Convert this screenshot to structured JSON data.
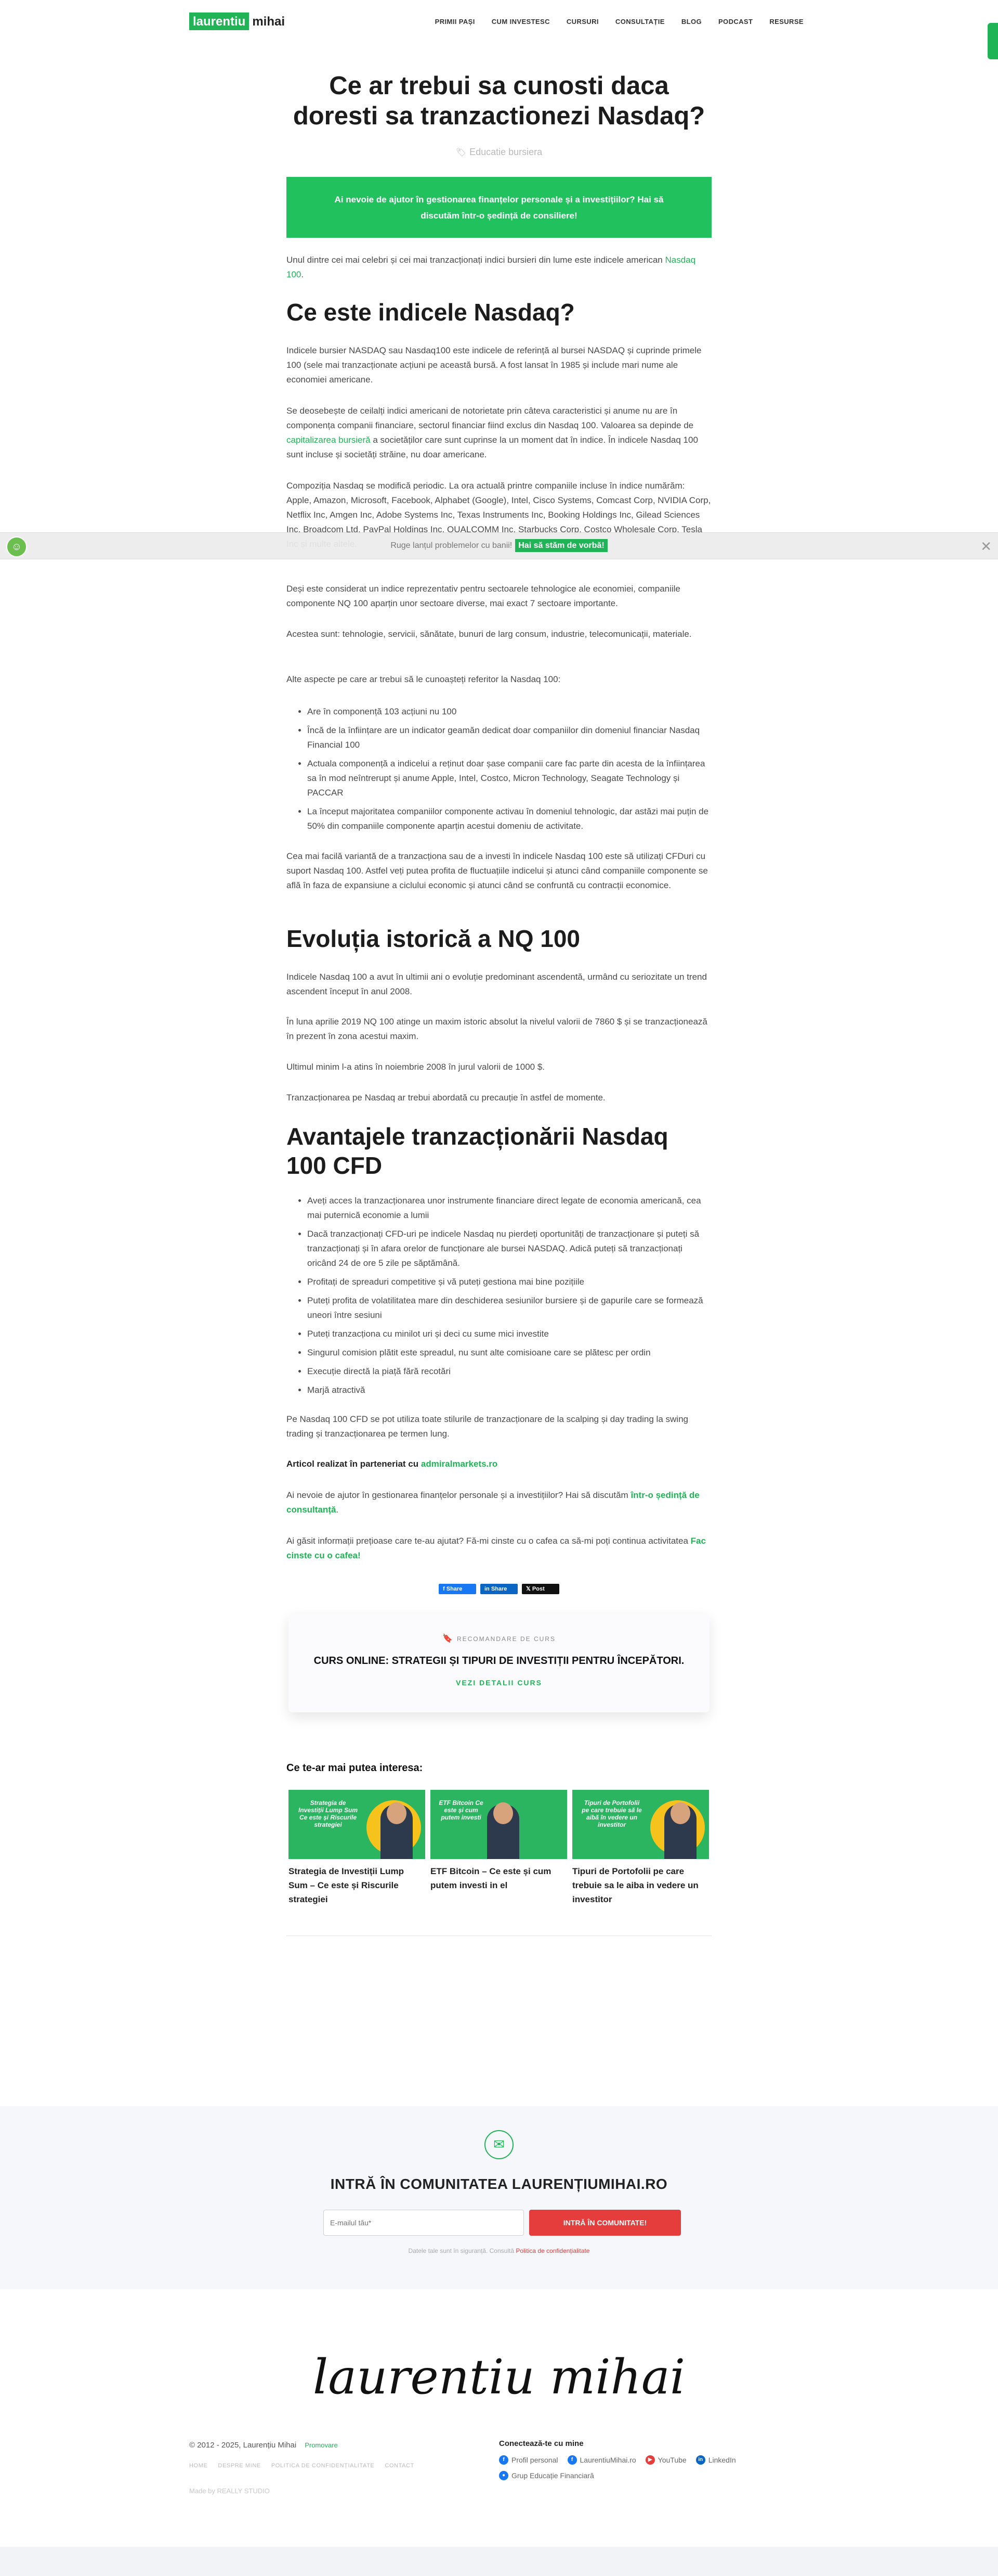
{
  "header": {
    "logo_part1": "laurentiu",
    "logo_part2": "mihai",
    "nav": [
      "PRIMII PAȘI",
      "CUM INVESTESC",
      "CURSURI",
      "CONSULTAȚIE",
      "BLOG",
      "PODCAST",
      "RESURSE"
    ]
  },
  "article": {
    "title": "Ce ar trebui sa cunosti daca doresti sa tranzactionezi Nasdaq?",
    "category": "Educatie bursiera",
    "cta_box": "Ai nevoie de ajutor în gestionarea finanțelor personale și a investițiilor? Hai să discutăm într-o ședință de consiliere!",
    "intro": "Unul dintre cei mai celebri și cei mai tranzacționați indici bursieri din lume este indicele american",
    "intro_link": "Nasdaq 100",
    "h2_1": "Ce este indicele Nasdaq?",
    "p1": "Indicele bursier NASDAQ sau Nasdaq100 este indicele de referință al bursei NASDAQ și cuprinde primele 100 (sele mai tranzacționate acțiuni pe această bursă. A fost lansat în 1985 și include mari nume ale economiei americane.",
    "p2a": "Se deosebește de ceilalți indici americani de notorietate prin câteva caracteristici și anume nu are în componența companii financiare, sectorul financiar fiind exclus din Nasdaq 100. Valoarea sa depinde de",
    "p2_link": "capitalizarea bursieră",
    "p2b": "a societăților care sunt cuprinse la un moment dat în indice. În indicele Nasdaq 100 sunt incluse și societăți străine, nu doar americane.",
    "p3": "Compoziția Nasdaq se modifică periodic. La ora actuală printre companiile incluse în indice numărăm: Apple, Amazon, Microsoft, Facebook, Alphabet (Google), Intel, Cisco Systems, Comcast Corp, NVIDIA Corp, Netflix Inc, Amgen Inc, Adobe Systems Inc, Texas Instruments Inc, Booking Holdings Inc, Gilead Sciences Inc, Broadcom Ltd, PayPal Holdings Inc, QUALCOMM Inc, Starbucks Corp, Costco Wholesale Corp, Tesla Inc și multe altele.",
    "p4": "Deși este considerat un indice reprezentativ pentru sectoarele tehnologice ale economiei, companiile componente NQ 100 aparțin unor sectoare diverse, mai exact 7 sectoare importante.",
    "p5": "Acestea sunt: tehnologie, servicii, sănătate, bunuri de larg consum, industrie, telecomunicații, materiale.",
    "p6": "Alte aspecte pe care ar trebui să le cunoașteți referitor la Nasdaq 100:",
    "list1": [
      "Are în componență 103 acțiuni nu 100",
      "Încă de la înființare are un indicator geamăn dedicat doar companiilor din domeniul financiar Nasdaq Financial 100",
      "Actuala componență a indicelui a reținut doar șase companii care fac parte din acesta de la înființarea sa în mod neîntrerupt și anume Apple, Intel, Costco, Micron Technology, Seagate Technology și PACCAR",
      "La început majoritatea companiilor componente activau în domeniul tehnologic, dar astăzi mai puțin de 50% din companiile componente aparțin acestui domeniu de activitate."
    ],
    "p7": "Cea mai facilă variantă de a tranzacționa sau de a investi în indicele Nasdaq 100 este să utilizați CFDuri cu suport Nasdaq 100. Astfel veți putea profita de fluctuațiile indicelui și atunci când companiile componente se află în faza de expansiune a ciclului economic și atunci când se confruntă cu contracții economice.",
    "h2_2": "Evoluția istorică a NQ 100",
    "p8": "Indicele Nasdaq 100 a avut în ultimii ani o evoluție predominant ascendentă, urmând cu seriozitate un trend ascendent început în anul 2008.",
    "p9": "În luna aprilie 2019 NQ 100 atinge un maxim istoric absolut la nivelul valorii de 7860 $ și se tranzacționează în prezent în zona acestui maxim.",
    "p10": "Ultimul minim l-a atins în noiembrie 2008 în jurul valorii de 1000 $.",
    "p11": "Tranzacționarea pe Nasdaq ar trebui abordată cu precauție în astfel de momente.",
    "h2_3": "Avantajele tranzacționării Nasdaq 100 CFD",
    "list2": [
      "Aveți acces la tranzacționarea unor instrumente financiare direct legate de economia americană, cea mai puternică economie a lumii",
      "Dacă tranzacționați CFD-uri pe indicele Nasdaq nu pierdeți oportunități de tranzacționare și puteți să tranzacționați și în afara orelor de funcționare ale bursei NASDAQ. Adică puteți să tranzacționați oricând 24 de ore 5 zile pe săptămână.",
      "Profitați de spreaduri competitive și vă puteți gestiona mai bine pozițiile",
      "Puteți profita de volatilitatea mare din deschiderea sesiunilor bursiere și de gapurile care se formează uneori între sesiuni",
      "Puteți tranzacționa cu minilot uri și deci cu sume mici investite",
      "Singurul comision plătit este spreadul, nu sunt alte comisioane care se plătesc per ordin",
      "Execuție directă la piață fără recotări",
      "Marjă atractivă"
    ],
    "p12": "Pe Nasdaq 100 CFD se pot utiliza toate stilurile de tranzacționare de la scalping și day trading la swing trading și tranzacționarea pe termen lung.",
    "partner_text": "Articol realizat în parteneriat cu",
    "partner_link": "admiralmarkets.ro",
    "p13": "Ai nevoie de ajutor în gestionarea finanțelor personale și a investițiilor? Hai să discutăm",
    "p13_link": "într-o ședință de consultanță",
    "p14": "Ai găsit informații prețioase care te-au ajutat? Fă-mi cinste cu o cafea ca să-mi poți continua activitatea",
    "p14_link": "Fac cinste cu o cafea!"
  },
  "notice": {
    "text": "Ruge lanțul problemelor cu banii!",
    "link": "Hai să stăm de vorbă!"
  },
  "share": {
    "facebook": "Share",
    "linkedin": "Share",
    "x": "Post"
  },
  "course": {
    "label": "RECOMANDARE DE CURS",
    "title": "CURS ONLINE: STRATEGII ȘI TIPURI DE INVESTIȚII PENTRU ÎNCEPĂTORI.",
    "link": "VEZI DETALII CURS"
  },
  "related": {
    "heading": "Ce te-ar mai putea interesa:",
    "items": [
      {
        "thumb_text": "Strategia de Investiții Lump Sum Ce este și Riscurile strategiei",
        "title": "Strategia de Investiții Lump Sum – Ce este și Riscurile strategiei"
      },
      {
        "thumb_text": "ETF Bitcoin Ce este și cum putem investi",
        "title": "ETF Bitcoin – Ce este și cum putem investi in el"
      },
      {
        "thumb_text": "Tipuri de Portofolii pe care trebuie să le aibă în vedere un investitor",
        "title": "Tipuri de Portofolii pe care trebuie sa le aiba in vedere un investitor"
      }
    ]
  },
  "newsletter": {
    "title": "INTRĂ ÎN COMUNITATEA LAURENȚIUMIHAI.RO",
    "placeholder": "E-mailul tău*",
    "button": "INTRĂ ÎN COMUNITATE!",
    "small": "Datele tale sunt în siguranță. Consultă",
    "small_link": "Politica de confidențialitate"
  },
  "footer": {
    "signature": "laurentiu mihai",
    "copyright": "© 2012 - 2025, Laurențiu Mihai",
    "promo": "Promovare",
    "links": [
      "HOME",
      "DESPRE MINE",
      "POLITICA DE CONFIDENȚIALITATE",
      "CONTACT"
    ],
    "made_by": "Made by REALLY STUDIO",
    "connect_title": "Conectează-te cu mine",
    "socials": [
      "Profil personal",
      "LaurentiuMihai.ro",
      "YouTube",
      "LinkedIn",
      "Grup Educație Financiară"
    ]
  },
  "colors": {
    "accent": "#21b456",
    "cta": "#21c25e",
    "red": "#e53c3c"
  }
}
